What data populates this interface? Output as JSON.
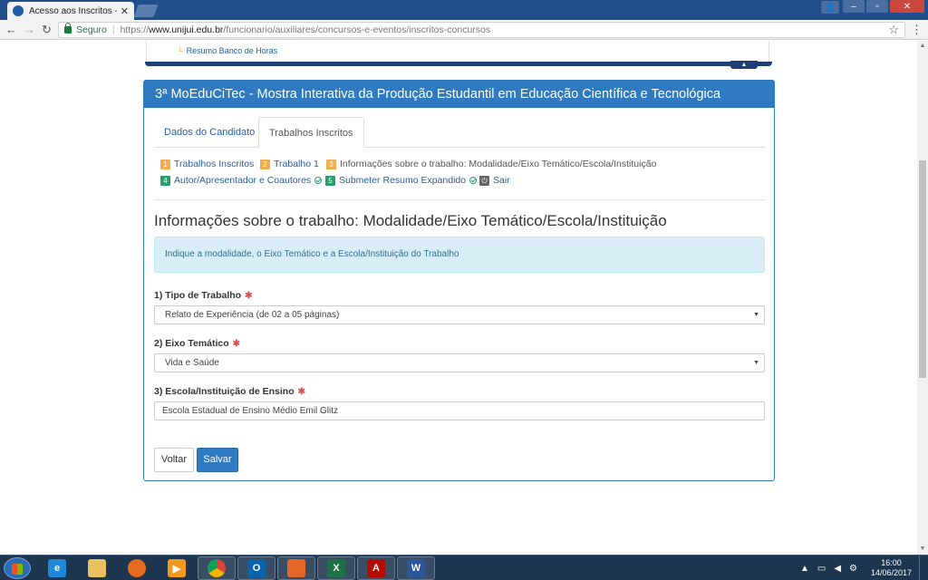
{
  "browser": {
    "tab_title": "Acesso aos Inscritos - Un",
    "tab_close": "✕",
    "secure_label": "Seguro",
    "url_prefix": "https://",
    "url_host": "www.unijui.edu.br",
    "url_path": "/funcionario/auxiliares/concursos-e-eventos/inscritos-concursos"
  },
  "top_menu": {
    "item": "Resumo Banco de Horas"
  },
  "panel": {
    "title": "3ª MoEduCiTec - Mostra Interativa da Produção Estudantil em Educação Científica e Tecnológica",
    "tabs": [
      {
        "label": "Dados do Candidato",
        "active": false
      },
      {
        "label": "Trabalhos Inscritos",
        "active": true
      }
    ]
  },
  "steps": [
    {
      "num": "1",
      "label": "Trabalhos Inscritos",
      "color": "#f0ad4e"
    },
    {
      "num": "2",
      "label": "Trabalho 1",
      "color": "#f0ad4e"
    },
    {
      "num": "3",
      "label": "Informações sobre o trabalho: Modalidade/Eixo Temático/Escola/Instituição",
      "color": "#f0ad4e"
    },
    {
      "num": "4",
      "label": "Autor/Apresentador e Coautores",
      "color": "#28a06b"
    },
    {
      "num": "5",
      "label": "Submeter Resumo Expandido",
      "color": "#28a06b"
    },
    {
      "num": "⏻",
      "label": "Sair",
      "color": "#666666"
    }
  ],
  "section": {
    "title": "Informações sobre o trabalho: Modalidade/Eixo Temático/Escola/Instituição",
    "info": "Indique a modalidade, o Eixo Temático e a Escola/Instituição do Trabalho"
  },
  "form": {
    "tipo_label": "1) Tipo de Trabalho",
    "tipo_value": "Relato de Experiência (de 02 a 05 páginas)",
    "eixo_label": "2) Eixo Temático",
    "eixo_value": "Vida e Saúde",
    "escola_label": "3) Escola/Instituição de Ensino",
    "escola_value": "Escola Estadual de Ensino Médio Emil Glitz",
    "required_mark": "✱"
  },
  "buttons": {
    "back": "Voltar",
    "save": "Salvar"
  },
  "taskbar": {
    "time": "16:00",
    "date": "14/06/2017"
  }
}
